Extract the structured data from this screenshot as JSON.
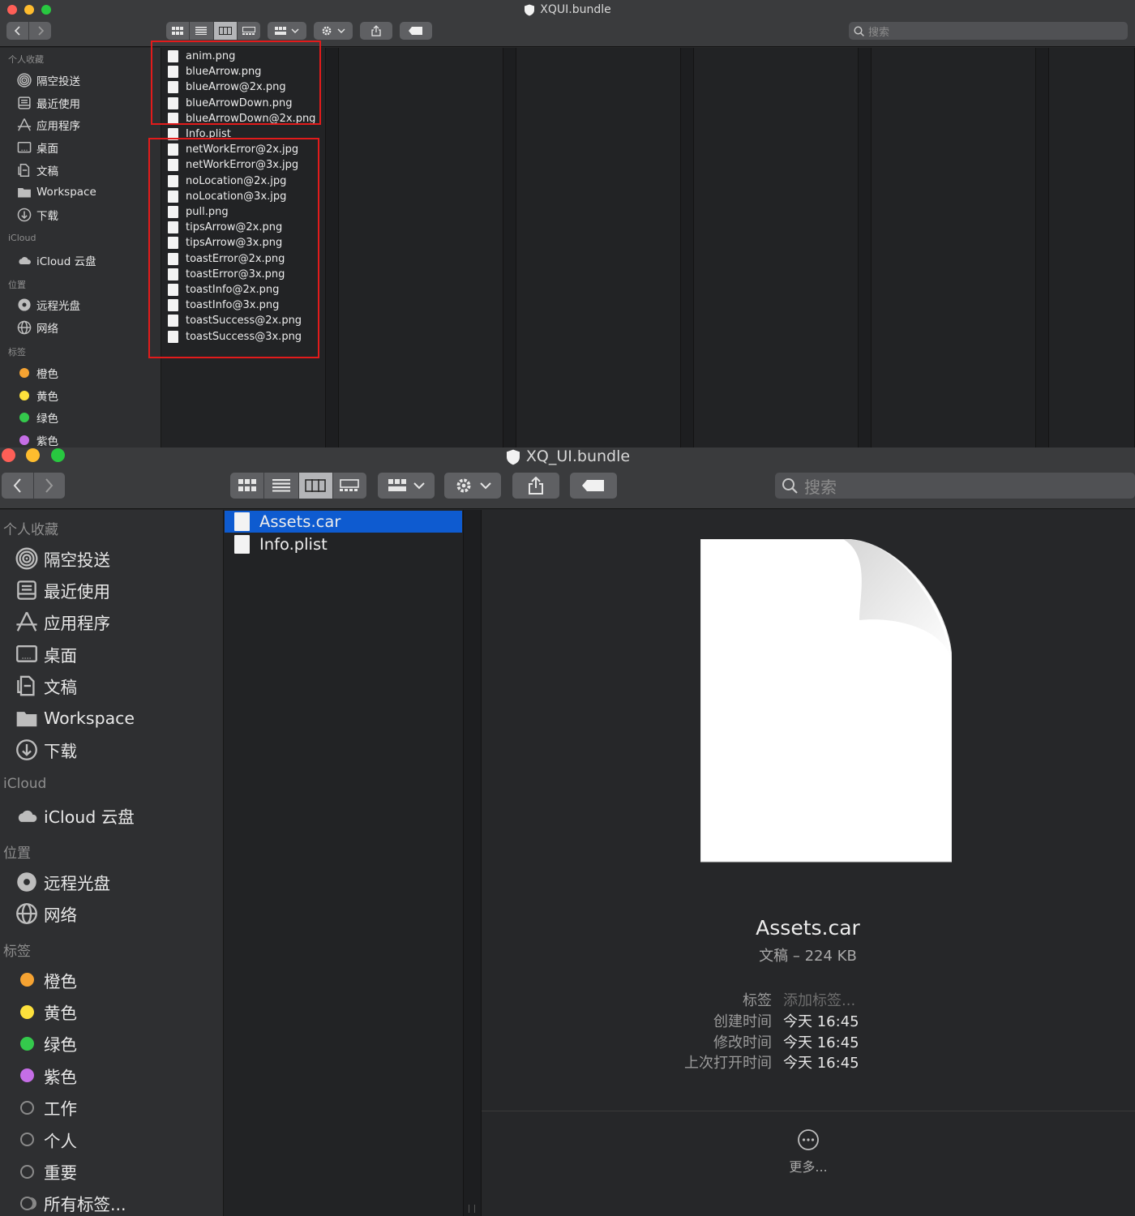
{
  "window_top": {
    "title": "XQUI.bundle",
    "search_placeholder": "搜索",
    "sidebar": {
      "favorites_header": "个人收藏",
      "favorites": [
        {
          "label": "隔空投送",
          "icon": "airdrop-icon"
        },
        {
          "label": "最近使用",
          "icon": "recents-icon"
        },
        {
          "label": "应用程序",
          "icon": "applications-icon"
        },
        {
          "label": "桌面",
          "icon": "desktop-icon"
        },
        {
          "label": "文稿",
          "icon": "documents-icon"
        },
        {
          "label": "Workspace",
          "icon": "folder-icon"
        },
        {
          "label": "下载",
          "icon": "downloads-icon"
        }
      ],
      "icloud_header": "iCloud",
      "icloud": [
        {
          "label": "iCloud 云盘",
          "icon": "cloud-icon"
        }
      ],
      "locations_header": "位置",
      "locations": [
        {
          "label": "远程光盘",
          "icon": "disc-icon"
        },
        {
          "label": "网络",
          "icon": "network-icon"
        }
      ],
      "tags_header": "标签",
      "tags": [
        {
          "label": "橙色",
          "color": "#f5a332"
        },
        {
          "label": "黄色",
          "color": "#fde13c"
        },
        {
          "label": "绿色",
          "color": "#34c94c"
        },
        {
          "label": "紫色",
          "color": "#c56ee6"
        }
      ]
    },
    "files": [
      "anim.png",
      "blueArrow.png",
      "blueArrow@2x.png",
      "blueArrowDown.png",
      "blueArrowDown@2x.png",
      "Info.plist",
      "netWorkError@2x.jpg",
      "netWorkError@3x.jpg",
      "noLocation@2x.jpg",
      "noLocation@3x.jpg",
      "pull.png",
      "tipsArrow@2x.png",
      "tipsArrow@3x.png",
      "toastError@2x.png",
      "toastError@3x.png",
      "toastInfo@2x.png",
      "toastInfo@3x.png",
      "toastSuccess@2x.png",
      "toastSuccess@3x.png"
    ]
  },
  "window_bottom": {
    "title": "XQ_UI.bundle",
    "search_placeholder": "搜索",
    "sidebar": {
      "favorites_header": "个人收藏",
      "favorites": [
        {
          "label": "隔空投送",
          "icon": "airdrop-icon"
        },
        {
          "label": "最近使用",
          "icon": "recents-icon"
        },
        {
          "label": "应用程序",
          "icon": "applications-icon"
        },
        {
          "label": "桌面",
          "icon": "desktop-icon"
        },
        {
          "label": "文稿",
          "icon": "documents-icon"
        },
        {
          "label": "Workspace",
          "icon": "folder-icon"
        },
        {
          "label": "下载",
          "icon": "downloads-icon"
        }
      ],
      "icloud_header": "iCloud",
      "icloud": [
        {
          "label": "iCloud 云盘",
          "icon": "cloud-icon"
        }
      ],
      "locations_header": "位置",
      "locations": [
        {
          "label": "远程光盘",
          "icon": "disc-icon"
        },
        {
          "label": "网络",
          "icon": "network-icon"
        }
      ],
      "tags_header": "标签",
      "tags": [
        {
          "label": "橙色",
          "color": "#f5a332"
        },
        {
          "label": "黄色",
          "color": "#fde13c"
        },
        {
          "label": "绿色",
          "color": "#34c94c"
        },
        {
          "label": "紫色",
          "color": "#c56ee6"
        },
        {
          "label": "工作",
          "color": "outline"
        },
        {
          "label": "个人",
          "color": "outline"
        },
        {
          "label": "重要",
          "color": "outline"
        },
        {
          "label": "所有标签...",
          "color": "multi"
        }
      ]
    },
    "files": [
      {
        "name": "Assets.car",
        "selected": true
      },
      {
        "name": "Info.plist",
        "selected": false
      }
    ],
    "preview": {
      "name": "Assets.car",
      "kind_size": "文稿 – 224 KB",
      "meta": [
        {
          "key": "标签",
          "value": "添加标签..."
        },
        {
          "key": "创建时间",
          "value": "今天 16:45"
        },
        {
          "key": "修改时间",
          "value": "今天 16:45"
        },
        {
          "key": "上次打开时间",
          "value": "今天 16:45"
        }
      ],
      "more_label": "更多..."
    }
  },
  "colors": {
    "selection": "#0e5bd0",
    "annotation_red": "#e21b1b"
  }
}
